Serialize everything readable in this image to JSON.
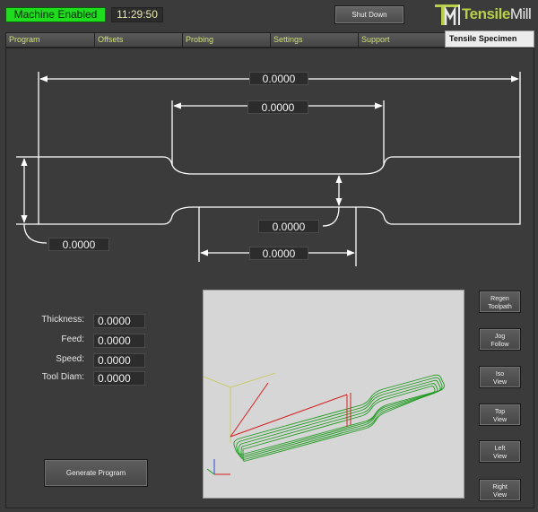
{
  "header": {
    "status": "Machine Enabled",
    "clock": "11:29:50",
    "shutdown_label": "Shut Down",
    "logo_brand": "Tensile",
    "logo_suffix": "Mill"
  },
  "tabs": [
    {
      "label": "Program"
    },
    {
      "label": "Offsets"
    },
    {
      "label": "Probing"
    },
    {
      "label": "Settings"
    },
    {
      "label": "Support"
    },
    {
      "label": "Tensile Specimen"
    }
  ],
  "dimensions": {
    "overall_length": "0.0000",
    "reduced_length": "0.0000",
    "grip_width": "0.0000",
    "fillet_radius": "0.0000",
    "gauge_length": "0.0000"
  },
  "params": [
    {
      "label": "Thickness:",
      "value": "0.0000"
    },
    {
      "label": "Feed:",
      "value": "0.0000"
    },
    {
      "label": "Speed:",
      "value": "0.0000"
    },
    {
      "label": "Tool Diam:",
      "value": "0.0000"
    }
  ],
  "generate_label": "Generate Program",
  "side_buttons": [
    {
      "line1": "Regen",
      "line2": "Toolpath"
    },
    {
      "line1": "Jog",
      "line2": "Follow"
    },
    {
      "line1": "Iso",
      "line2": "View"
    },
    {
      "line1": "Top",
      "line2": "View"
    },
    {
      "line1": "Left",
      "line2": "View"
    },
    {
      "line1": "Right",
      "line2": "View"
    }
  ],
  "colors": {
    "status_green": "#1fdc1f",
    "accent_olive": "#b8cf4a",
    "toolpath_green": "#1e9a1e",
    "tool_red": "#d42020"
  }
}
